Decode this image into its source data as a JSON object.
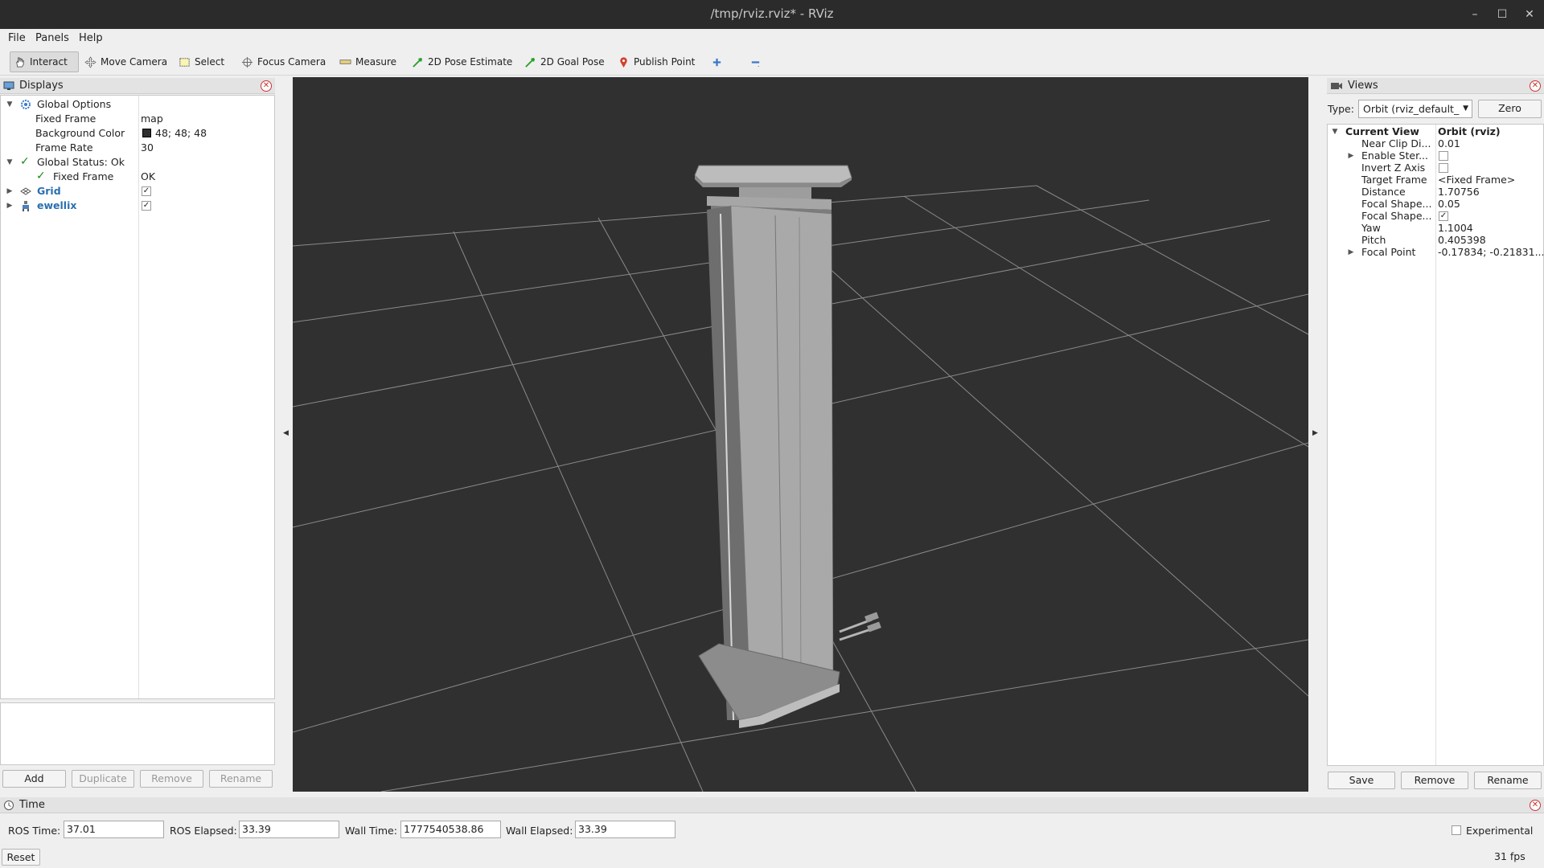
{
  "window": {
    "title": "/tmp/rviz.rviz* - RViz"
  },
  "menu": {
    "file": "File",
    "panels": "Panels",
    "help": "Help"
  },
  "toolbar": {
    "interact": "Interact",
    "move_camera": "Move Camera",
    "select": "Select",
    "focus_camera": "Focus Camera",
    "measure": "Measure",
    "pose_estimate": "2D Pose Estimate",
    "goal_pose": "2D Goal Pose",
    "publish_point": "Publish Point"
  },
  "displays": {
    "title": "Displays",
    "global_options": "Global Options",
    "fixed_frame_label": "Fixed Frame",
    "fixed_frame_value": "map",
    "background_color_label": "Background Color",
    "background_color_value": "48; 48; 48",
    "background_color_hex": "#303030",
    "frame_rate_label": "Frame Rate",
    "frame_rate_value": "30",
    "global_status": "Global Status: Ok",
    "status_fixed_frame_label": "Fixed Frame",
    "status_fixed_frame_value": "OK",
    "grid": "Grid",
    "ewellix": "ewellix",
    "buttons": {
      "add": "Add",
      "duplicate": "Duplicate",
      "remove": "Remove",
      "rename": "Rename"
    }
  },
  "views": {
    "title": "Views",
    "type_label": "Type:",
    "type_value": "Orbit (rviz_default_",
    "zero": "Zero",
    "current_view": "Current View",
    "current_view_value": "Orbit (rviz)",
    "props": [
      {
        "label": "Near Clip Di...",
        "value": "0.01"
      },
      {
        "label": "Enable Ster...",
        "value": ""
      },
      {
        "label": "Invert Z Axis",
        "value": ""
      },
      {
        "label": "Target Frame",
        "value": "<Fixed Frame>"
      },
      {
        "label": "Distance",
        "value": "1.70756"
      },
      {
        "label": "Focal Shape...",
        "value": "0.05"
      },
      {
        "label": "Focal Shape...",
        "value": ""
      },
      {
        "label": "Yaw",
        "value": "1.1004"
      },
      {
        "label": "Pitch",
        "value": "0.405398"
      },
      {
        "label": "Focal Point",
        "value": "-0.17834; -0.21831..."
      }
    ],
    "buttons": {
      "save": "Save",
      "remove": "Remove",
      "rename": "Rename"
    }
  },
  "time": {
    "title": "Time",
    "ros_time_label": "ROS Time:",
    "ros_time": "37.01",
    "ros_elapsed_label": "ROS Elapsed:",
    "ros_elapsed": "33.39",
    "wall_time_label": "Wall Time:",
    "wall_time": "1777540538.86",
    "wall_elapsed_label": "Wall Elapsed:",
    "wall_elapsed": "33.39",
    "experimental": "Experimental",
    "reset": "Reset",
    "fps": "31 fps"
  },
  "colors": {
    "accent_link": "#2a6fb0",
    "status_ok": "#1a8a1a",
    "close_red": "#cc3333"
  }
}
